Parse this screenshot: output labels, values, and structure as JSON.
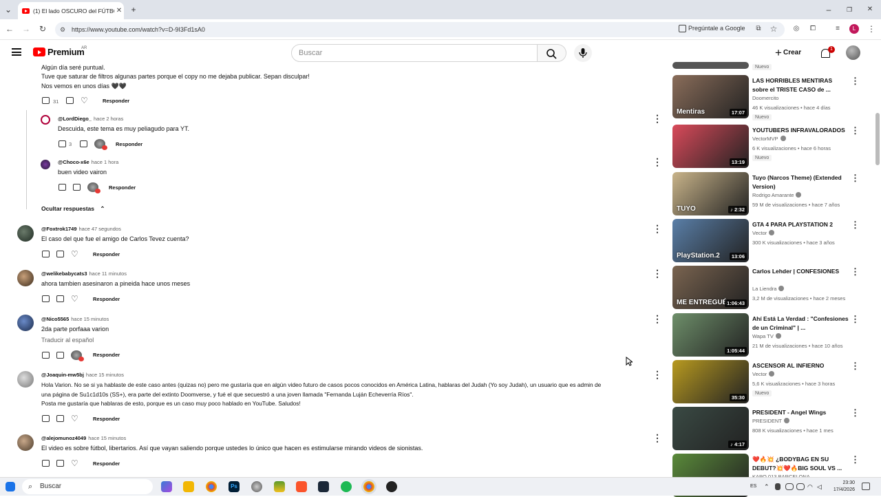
{
  "browser": {
    "tab_title": "(1) El lado OSCURO del FÚTBOL",
    "url": "https://www.youtube.com/watch?v=D-9I3Fd1sA0",
    "ask_google": "Pregúntale a Google"
  },
  "header": {
    "brand": "Premium",
    "region": "AR",
    "search_placeholder": "Buscar",
    "create_label": "Crear",
    "notif_count": "1"
  },
  "comments": {
    "top_text_1": "Algún día seré puntual.",
    "top_text_2": "Tuve que saturar de filtros algunas partes porque el copy no me dejaba publicar. Sepan disculpar!",
    "top_text_3": "Nos vemos en unos días 🖤🖤",
    "top_likes": "31",
    "reply_label": "Responder",
    "hide_replies": "Ocultar respuestas",
    "translate": "Traducir al español",
    "replies": [
      {
        "author": "@LordDiego_",
        "time": "hace 2 horas",
        "text": "Descuida, este tema es muy peliagudo para YT.",
        "likes": "3"
      },
      {
        "author": "@Choco-x6e",
        "time": "hace 1 hora",
        "text": "buen video vairon",
        "likes": ""
      }
    ],
    "items": [
      {
        "author": "@Foxtrok1749",
        "time": "hace 47 segundos",
        "text": "El caso del que fue el amigo de Carlos Tevez cuenta?"
      },
      {
        "author": "@welikebabycats3",
        "time": "hace 11 minutos",
        "text": "ahora tambien asesinaron a pineida hace unos meses"
      },
      {
        "author": "@Nico5565",
        "time": "hace 15 minutos",
        "text": "2da parte porfaaa varion"
      },
      {
        "author": "@Joaquin-mw5bj",
        "time": "hace 15 minutos",
        "text": "Hola Varion. No se si ya hablaste de este caso antes (quizas no) pero me gustaría que en algún video futuro de casos pocos conocidos en América Latina, hablaras del Judah (Yo soy Judah), un usuario que es admin de",
        "text2": "una página de Su1c1d10s (SS+), era parte del extinto Doomverse, y fué el que secuestró a una joven llamada \"Fernanda Luján Echeverría Ríos\".",
        "text3": "Posta me gustaría que hablaras de esto, porque es un caso muy poco hablado en YouTube. Saludos!"
      },
      {
        "author": "@alejomunoz4049",
        "time": "hace 15 minutos",
        "text": "El video es sobre fútbol, libertarios. Así que vayan saliendo porque ustedes lo único que hacen es estimularse mirando videos de sionistas."
      }
    ]
  },
  "sidebar": {
    "new_label": "Nuevo",
    "videos": [
      {
        "title": "LAS HORRIBLES MENTIRAS sobre el TRISTE CASO de ...",
        "channel": "Doomercito",
        "meta": "46 K visualizaciones • hace 4 días",
        "duration": "17:07",
        "new": true,
        "thumb_text": "Mentiras",
        "color": "#8a6d5a"
      },
      {
        "title": "YOUTUBERS INFRAVALORADOS",
        "channel": "VectorMVP",
        "meta": "6 K visualizaciones • hace 6 horas",
        "duration": "13:19",
        "new": true,
        "color": "#d94a5a"
      },
      {
        "title": "Tuyo (Narcos Theme) (Extended Version)",
        "channel": "Rodrigo Amarante",
        "meta": "59 M de visualizaciones • hace 7 años",
        "duration": "♪ 2:32",
        "new": false,
        "thumb_text": "TUYO",
        "color": "#c9b48a"
      },
      {
        "title": "GTA 4 PARA PLAYSTATION 2",
        "channel": "Vector",
        "meta": "300 K visualizaciones • hace 3 años",
        "duration": "13:06",
        "new": false,
        "thumb_text": "PlayStation.2",
        "color": "#5a7fa8"
      },
      {
        "title": "Carlos Lehder | CONFESIONES",
        "channel": "La Liendra",
        "meta": "3,2 M de visualizaciones • hace 2 meses",
        "duration": "1:06:43",
        "new": false,
        "thumb_text": "ME ENTREGUÉ",
        "color": "#7a6450"
      },
      {
        "title": "Ahí Está La Verdad : \"Confesiones de un Criminal\" | ...",
        "channel": "Wapa TV",
        "meta": "21 M de visualizaciones • hace 10 años",
        "duration": "1:05:44",
        "new": false,
        "color": "#6e8f6a"
      },
      {
        "title": "ASCENSOR AL INFIERNO",
        "channel": "Vector",
        "meta": "5,6 K visualizaciones • hace 3 horas",
        "duration": "35:30",
        "new": true,
        "color": "#b89a20"
      },
      {
        "title": "PRESIDENT - Angel Wings",
        "channel": "PRESIDENT",
        "meta": "808 K visualizaciones • hace 1 mes",
        "duration": "♪ 4:17",
        "new": false,
        "color": "#3a4a44"
      },
      {
        "title": "❤️🔥💥 ¿BODYBAG EN SU DEBUT?💥❤️🔥BIG SOUL VS ...",
        "channel": "KAPO 013 BARCELONA",
        "meta": "",
        "duration": "",
        "new": false,
        "color": "#5a8a3a"
      }
    ]
  },
  "taskbar": {
    "search": "Buscar",
    "lang": "ES",
    "time": "23:30",
    "date": "17/4/2026"
  }
}
